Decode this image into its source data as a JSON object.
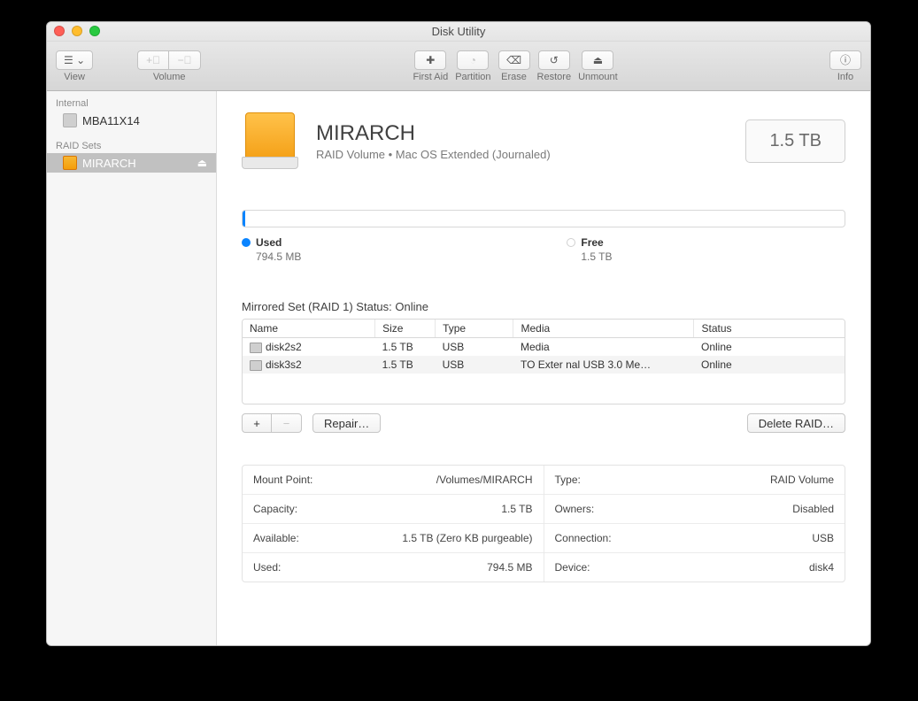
{
  "title": "Disk Utility",
  "toolbar": {
    "view": "View",
    "volume": "Volume",
    "first_aid": "First Aid",
    "partition": "Partition",
    "erase": "Erase",
    "restore": "Restore",
    "unmount": "Unmount",
    "info": "Info"
  },
  "sidebar": {
    "internal_label": "Internal",
    "internal_items": [
      {
        "name": "MBA11X14"
      }
    ],
    "raid_label": "RAID Sets",
    "raid_items": [
      {
        "name": "MIRARCH"
      }
    ]
  },
  "header": {
    "name": "MIRARCH",
    "subtitle": "RAID Volume • Mac OS Extended (Journaled)",
    "size": "1.5 TB"
  },
  "usage": {
    "used_label": "Used",
    "used_value": "794.5 MB",
    "free_label": "Free",
    "free_value": "1.5 TB"
  },
  "raid": {
    "status_line": "Mirrored Set (RAID 1) Status: Online",
    "cols": {
      "name": "Name",
      "size": "Size",
      "type": "Type",
      "media": "Media",
      "status": "Status"
    },
    "rows": [
      {
        "name": "disk2s2",
        "size": "1.5 TB",
        "type": "USB",
        "media": "Media",
        "status": "Online"
      },
      {
        "name": "disk3s2",
        "size": "1.5 TB",
        "type": "USB",
        "media": "TO Exter nal USB 3.0 Me…",
        "status": "Online"
      }
    ],
    "add": "+",
    "remove": "−",
    "repair": "Repair…",
    "delete": "Delete RAID…"
  },
  "info": {
    "left": [
      {
        "k": "Mount Point:",
        "v": "/Volumes/MIRARCH"
      },
      {
        "k": "Capacity:",
        "v": "1.5 TB"
      },
      {
        "k": "Available:",
        "v": "1.5 TB (Zero KB purgeable)"
      },
      {
        "k": "Used:",
        "v": "794.5 MB"
      }
    ],
    "right": [
      {
        "k": "Type:",
        "v": "RAID Volume"
      },
      {
        "k": "Owners:",
        "v": "Disabled"
      },
      {
        "k": "Connection:",
        "v": "USB"
      },
      {
        "k": "Device:",
        "v": "disk4"
      }
    ]
  }
}
